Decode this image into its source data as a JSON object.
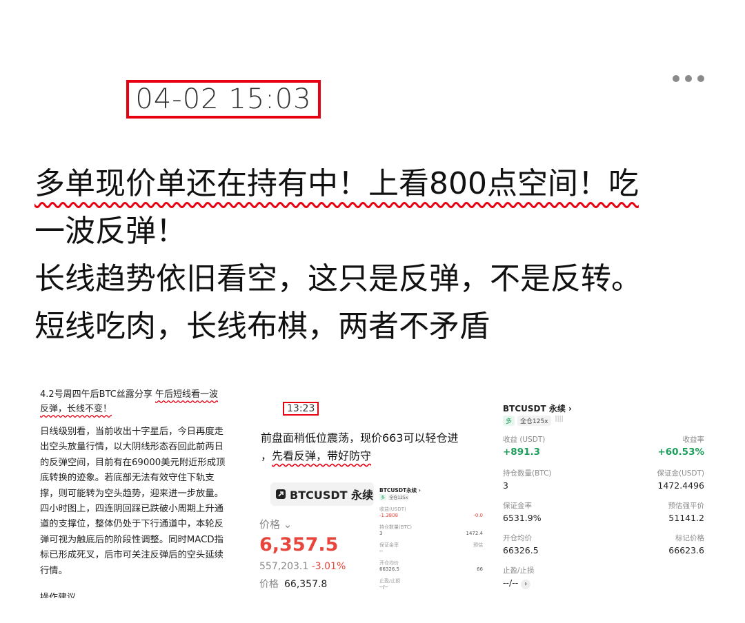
{
  "header": {
    "more_icon": "more-horizontal-icon"
  },
  "timestamp": "04-02 15:03",
  "post_lines": [
    "多单现价单还在持有中！上看800点空间！吃",
    "一波反弹！",
    "长线趋势依旧看空，这只是反弹，不是反转。",
    "短线吃肉，长线布棋，两者不矛盾"
  ],
  "shot1": {
    "head_plain": "4.2号周四午后BTC丝露分享",
    "head_wavy_1": "午后短线看一波",
    "head_wavy_2": "反弹，长线不变！",
    "body": [
      "日线级别看，当前收出十字星后，今日再度走",
      "出空头放量行情，以大阴线形态吞回此前两日",
      "的反弹空间，目前有在69000美元附近形成顶",
      "底转换的迹象。若底部无法有效守住下轨支",
      "撑，则可能转为空头趋势，迎来进一步放量。",
      "四小时图上，四连阴回踩已跌破小周期上升通",
      "道的支撑位，整体仍处于下行通道中，本轮反",
      "弹可视为触底后的阶段性调整。同时MACD指",
      "标已形成死叉，后市可关注反弹后的空头延续",
      "行情。"
    ],
    "foot": "操作建议"
  },
  "shot2": {
    "time": "13:23",
    "line1": "前盘面稍低位震荡，现价663可以轻仓进",
    "line2_prefix": "，",
    "line2_wavy": "先看反弹，带好防守",
    "symbol": "BTCUSDT 永续",
    "price_label": "价格 ⌄",
    "price": "6,357.5",
    "sub_prefix": "557,203.1",
    "sub_change": "-3.01%",
    "mark_label": "价格",
    "mark_value": "66,357.8",
    "mini": {
      "title": "BTCUSDT永续 ›",
      "tag1": "多",
      "tag2": "全仓125x",
      "r1l": "收益(USDT)",
      "r1v": "-1.3808",
      "r1r": "-0.0",
      "r2l": "持仓数量(BTC)",
      "r2v": "3",
      "r2r": "1472.4",
      "r3l": "保证金率",
      "r3v": "--",
      "r3r": "预估",
      "r4l": "开仓均价",
      "r4v": "66326.5",
      "r4r": "66",
      "r5l": "止盈/止损",
      "r5v": "--/--"
    }
  },
  "shot3": {
    "title": "BTCUSDT 永续 ›",
    "tag_long": "多",
    "tag_margin": "全仓125x",
    "signal": "||||",
    "rows": [
      {
        "label_l": "收益 (USDT)",
        "val_l": "+891.3",
        "label_r": "收益率",
        "val_r": "+60.53%"
      },
      {
        "label_l": "持仓数量(BTC)",
        "val_l": "3",
        "label_r": "保证金(USDT)",
        "val_r": "1472.4496"
      },
      {
        "label_l": "保证金率",
        "val_l": "6531.9%",
        "label_r": "预估强平价",
        "val_r": "51141.2"
      },
      {
        "label_l": "开仓均价",
        "val_l": "66326.5",
        "label_r": "标记价格",
        "val_r": "66623.6"
      }
    ],
    "tpsl_label": "止盈/止损",
    "tpsl_value": "--/--"
  },
  "colors": {
    "accent_red": "#e60012",
    "gain_green": "#1a9e5a",
    "loss_red": "#e8453c"
  }
}
